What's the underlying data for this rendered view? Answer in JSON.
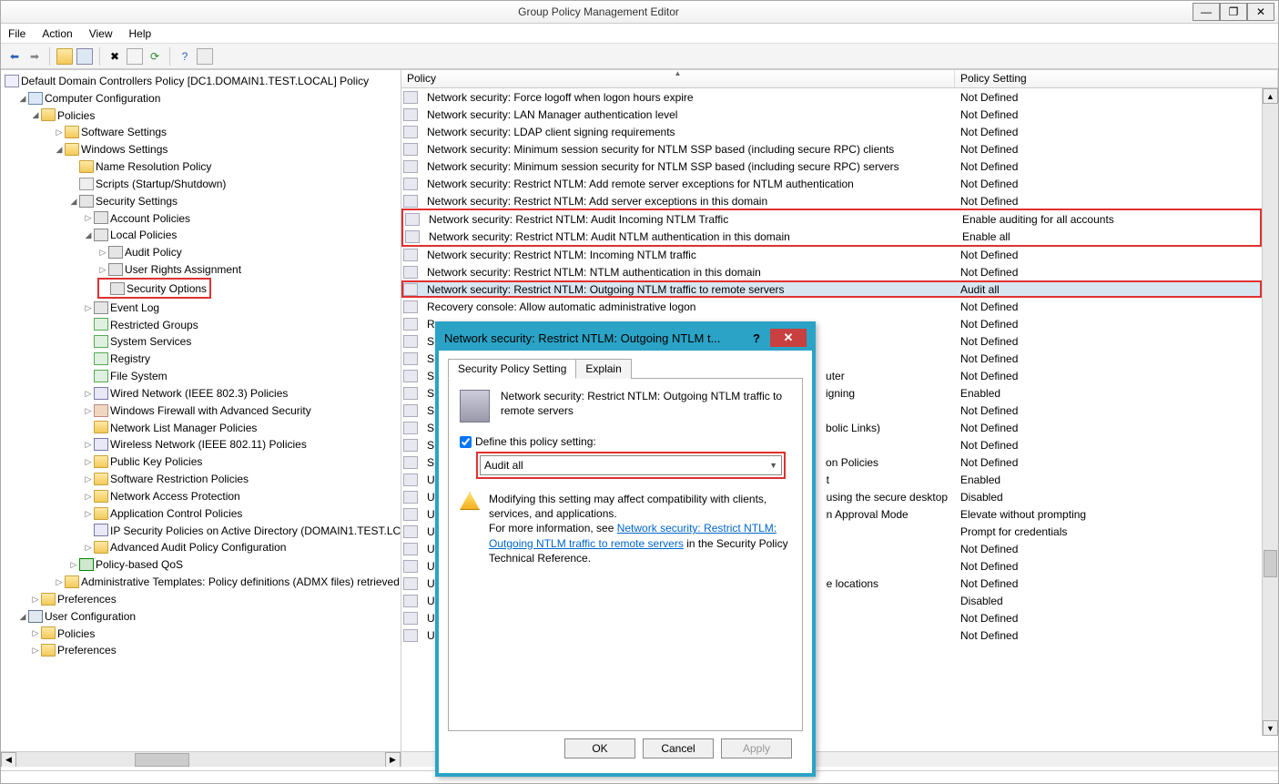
{
  "title": "Group Policy Management Editor",
  "menu": {
    "file": "File",
    "action": "Action",
    "view": "View",
    "help": "Help"
  },
  "tree": {
    "root": "Default Domain Controllers Policy [DC1.DOMAIN1.TEST.LOCAL] Policy",
    "comp_config": "Computer Configuration",
    "policies": "Policies",
    "soft_settings": "Software Settings",
    "win_settings": "Windows Settings",
    "name_res": "Name Resolution Policy",
    "scripts": "Scripts (Startup/Shutdown)",
    "sec_settings": "Security Settings",
    "acct_policies": "Account Policies",
    "local_policies": "Local Policies",
    "audit_policy": "Audit Policy",
    "user_rights": "User Rights Assignment",
    "sec_options": "Security Options",
    "event_log": "Event Log",
    "restricted": "Restricted Groups",
    "sys_services": "System Services",
    "registry": "Registry",
    "file_system": "File System",
    "wired": "Wired Network (IEEE 802.3) Policies",
    "firewall": "Windows Firewall with Advanced Security",
    "netlist": "Network List Manager Policies",
    "wireless": "Wireless Network (IEEE 802.11) Policies",
    "pubkey": "Public Key Policies",
    "softrest": "Software Restriction Policies",
    "nap": "Network Access Protection",
    "appctrl": "Application Control Policies",
    "ipsec": "IP Security Policies on Active Directory (DOMAIN1.TEST.LC",
    "advaudit": "Advanced Audit Policy Configuration",
    "qos": "Policy-based QoS",
    "admin_templ": "Administrative Templates: Policy definitions (ADMX files) retrieved",
    "preferences": "Preferences",
    "user_config": "User Configuration",
    "u_policies": "Policies",
    "u_prefs": "Preferences"
  },
  "list": {
    "head_policy": "Policy",
    "head_setting": "Policy Setting",
    "rows": [
      {
        "p": "Network security: Force logoff when logon hours expire",
        "s": "Not Defined"
      },
      {
        "p": "Network security: LAN Manager authentication level",
        "s": "Not Defined"
      },
      {
        "p": "Network security: LDAP client signing requirements",
        "s": "Not Defined"
      },
      {
        "p": "Network security: Minimum session security for NTLM SSP based (including secure RPC) clients",
        "s": "Not Defined"
      },
      {
        "p": "Network security: Minimum session security for NTLM SSP based (including secure RPC) servers",
        "s": "Not Defined"
      },
      {
        "p": "Network security: Restrict NTLM: Add remote server exceptions for NTLM authentication",
        "s": "Not Defined"
      },
      {
        "p": "Network security: Restrict NTLM: Add server exceptions in this domain",
        "s": "Not Defined"
      },
      {
        "p": "Network security: Restrict NTLM: Audit Incoming NTLM Traffic",
        "s": "Enable auditing for all accounts"
      },
      {
        "p": "Network security: Restrict NTLM: Audit NTLM authentication in this domain",
        "s": "Enable all"
      },
      {
        "p": "Network security: Restrict NTLM: Incoming NTLM traffic",
        "s": "Not Defined"
      },
      {
        "p": "Network security: Restrict NTLM: NTLM authentication in this domain",
        "s": "Not Defined"
      },
      {
        "p": "Network security: Restrict NTLM: Outgoing NTLM traffic to remote servers",
        "s": "Audit all"
      },
      {
        "p": "Recovery console: Allow automatic administrative logon",
        "s": "Not Defined"
      },
      {
        "p": "R",
        "s": "Not Defined"
      },
      {
        "p": "S",
        "s": "Not Defined"
      },
      {
        "p": "S",
        "s": "Not Defined"
      },
      {
        "p": "S   (…uter)",
        "s": "Not Defined",
        "suffix": "uter"
      },
      {
        "p": "S   (…igning)",
        "s": "Enabled",
        "suffix": "igning"
      },
      {
        "p": "S",
        "s": "Not Defined"
      },
      {
        "p": "S   (…bolic Links)",
        "s": "Not Defined",
        "suffix": "bolic Links)"
      },
      {
        "p": "S",
        "s": "Not Defined"
      },
      {
        "p": "S   (…on Policies)",
        "s": "Not Defined",
        "suffix": "on Policies"
      },
      {
        "p": "U   (…t)",
        "s": "Enabled",
        "suffix": "t"
      },
      {
        "p": "U   (…using the secure desktop)",
        "s": "Disabled",
        "suffix": "using the secure desktop"
      },
      {
        "p": "U   (…n Approval Mode)",
        "s": "Elevate without prompting",
        "suffix": "n Approval Mode"
      },
      {
        "p": "U",
        "s": "Prompt for credentials"
      },
      {
        "p": "U",
        "s": "Not Defined"
      },
      {
        "p": "U",
        "s": "Not Defined"
      },
      {
        "p": "U   (…e locations)",
        "s": "Not Defined",
        "suffix": "e locations"
      },
      {
        "p": "U",
        "s": "Disabled"
      },
      {
        "p": "U",
        "s": "Not Defined"
      },
      {
        "p": "U",
        "s": "Not Defined"
      }
    ]
  },
  "dialog": {
    "title": "Network security: Restrict NTLM: Outgoing NTLM t...",
    "tab1": "Security Policy Setting",
    "tab2": "Explain",
    "policy_name": "Network security: Restrict NTLM: Outgoing NTLM traffic to remote servers",
    "define_label": "Define this policy setting:",
    "combo_value": "Audit all",
    "warn_text1": "Modifying this setting may affect compatibility with clients, services, and applications.",
    "warn_text2a": "For more information, see ",
    "warn_link": "Network security: Restrict NTLM: Outgoing NTLM traffic to remote servers",
    "warn_text2b": " in the Security Policy Technical Reference.",
    "ok": "OK",
    "cancel": "Cancel",
    "apply": "Apply"
  }
}
